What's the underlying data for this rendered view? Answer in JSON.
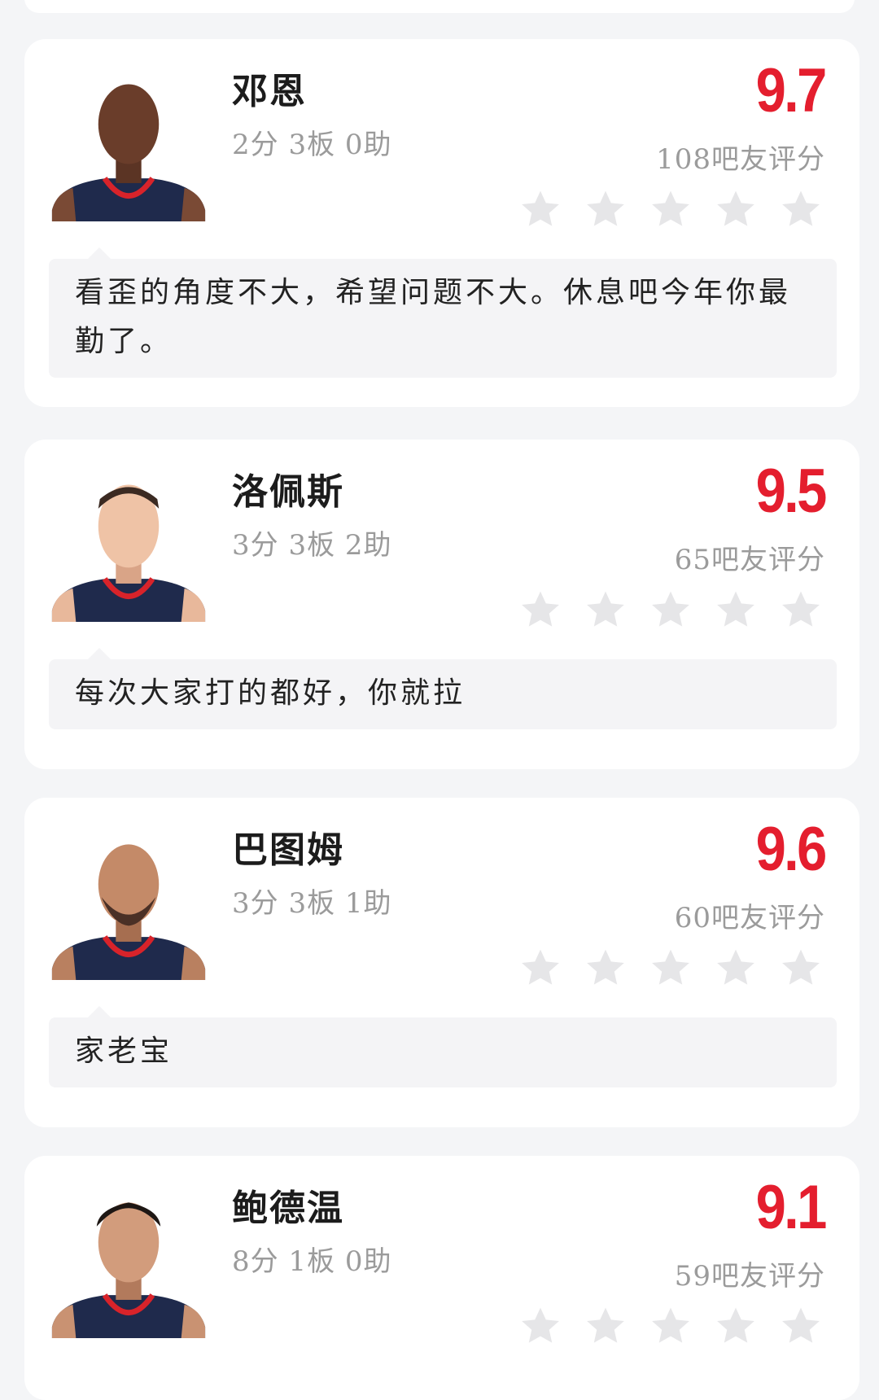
{
  "colors": {
    "background": "#f4f5f7",
    "card": "#ffffff",
    "score": "#e41e2e",
    "muted": "#9b9b9b",
    "star": "#e6e6e8",
    "comment_bg": "#f4f4f6",
    "jersey": "#1f2a4c",
    "jersey_trim": "#d8232a"
  },
  "players": [
    {
      "name": "邓恩",
      "stats": "2分 3板 0助",
      "score": "9.7",
      "rating_count": "108吧友评分",
      "stars_filled": 0,
      "comment": "看歪的角度不大，希望问题不大。休息吧今年你最勤了。",
      "avatar_icon": "player-headshot-icon"
    },
    {
      "name": "洛佩斯",
      "stats": "3分 3板 2助",
      "score": "9.5",
      "rating_count": "65吧友评分",
      "stars_filled": 0,
      "comment": "每次大家打的都好，你就拉",
      "avatar_icon": "player-headshot-icon"
    },
    {
      "name": "巴图姆",
      "stats": "3分 3板 1助",
      "score": "9.6",
      "rating_count": "60吧友评分",
      "stars_filled": 0,
      "comment": "家老宝",
      "avatar_icon": "player-headshot-icon"
    },
    {
      "name": "鲍德温",
      "stats": "8分 1板 0助",
      "score": "9.1",
      "rating_count": "59吧友评分",
      "stars_filled": 0,
      "comment": "",
      "avatar_icon": "player-headshot-icon"
    }
  ]
}
